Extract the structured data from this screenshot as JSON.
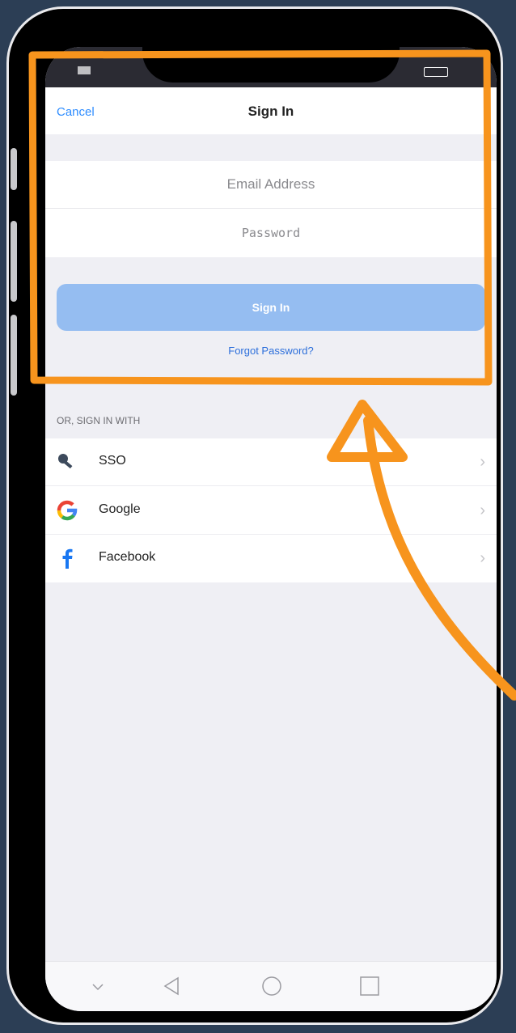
{
  "navbar": {
    "cancel": "Cancel",
    "title": "Sign In"
  },
  "form": {
    "email_placeholder": "Email Address",
    "password_placeholder": "Password",
    "submit": "Sign In",
    "forgot": "Forgot Password?"
  },
  "alt_signin": {
    "label": "OR, SIGN IN WITH",
    "options": [
      {
        "label": "SSO",
        "icon": "key-icon"
      },
      {
        "label": "Google",
        "icon": "google-icon"
      },
      {
        "label": "Facebook",
        "icon": "facebook-icon"
      }
    ]
  },
  "android_nav": {
    "icons": [
      "chevron-down-icon",
      "back-icon",
      "home-icon",
      "recents-icon"
    ]
  },
  "colors": {
    "accent": "#2d8cff",
    "button": "#95bdf1",
    "annotation": "#f7941d"
  }
}
